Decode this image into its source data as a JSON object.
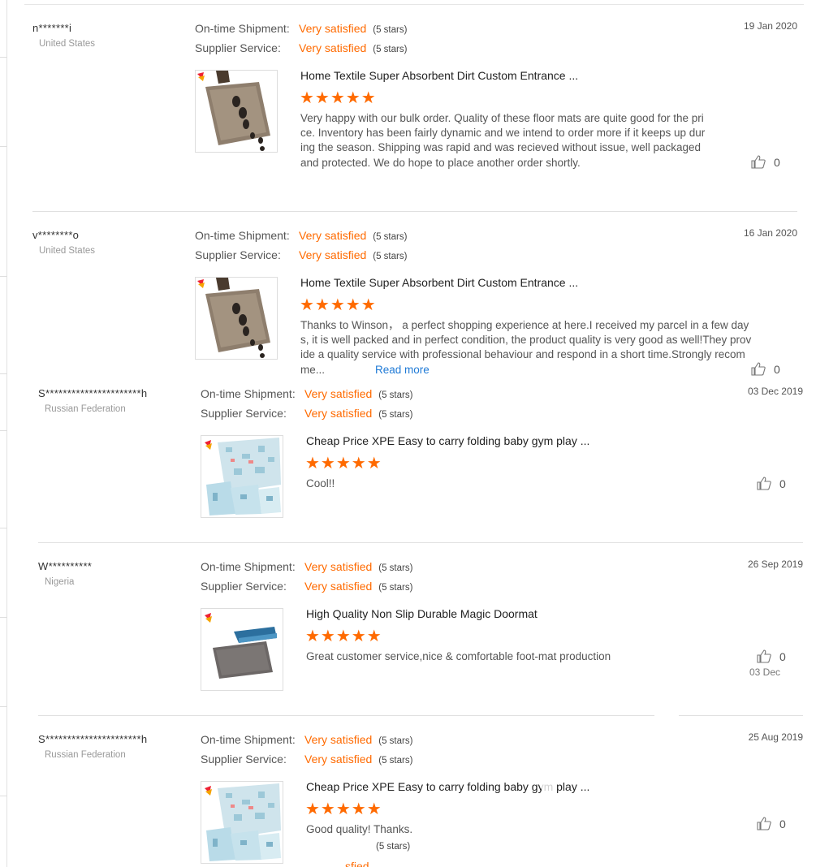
{
  "labels": {
    "shipment": "On-time Shipment:",
    "service": "Supplier Service:"
  },
  "stars_glyph": "★★★★★",
  "icons": {
    "like": "thumbs-up-icon",
    "brand_logo": "supplier-logo-icon"
  },
  "colors": {
    "accent": "#ff6a00",
    "link": "#1f7ad6",
    "muted": "#999999"
  },
  "reviews": [
    {
      "name": "n*******i",
      "country": "United States",
      "shipment_rating": "Very satisfied",
      "shipment_stars": "(5 stars)",
      "service_rating": "Very satisfied",
      "service_stars": "(5 stars)",
      "date": "19 Jan 2020",
      "product_title": "Home Textile Super Absorbent Dirt Custom Entrance ...",
      "product_image": "doormat-footprints",
      "product_stars": 5,
      "text": "Very happy with our bulk order. Quality of these floor mats are quite good for the price. Inventory has been fairly dynamic and we intend to order more if it keeps up during the season. Shipping was rapid and was recieved without issue, well packaged and protected. We do hope to place another order shortly.",
      "likes": "0"
    },
    {
      "name": "v********o",
      "country": "United States",
      "shipment_rating": "Very satisfied",
      "shipment_stars": "(5 stars)",
      "service_rating": "Very satisfied",
      "service_stars": "(5 stars)",
      "date": "16 Jan 2020",
      "product_title": "Home Textile Super Absorbent Dirt Custom Entrance ...",
      "product_image": "doormat-footprints",
      "product_stars": 5,
      "text": "Thanks to Winson， a perfect shopping experience at here.I received my parcel in a few days, it is well packed and in perfect condition, the product quality is very good as well!They provide a quality service with professional behaviour and respond in a short time.Strongly recomme...",
      "read_more": "Read more",
      "likes": "0"
    },
    {
      "name": "S**********************h",
      "country": "Russian Federation",
      "shipment_rating": "Very satisfied",
      "shipment_stars": "(5 stars)",
      "service_rating": "Very satisfied",
      "service_stars": "(5 stars)",
      "date": "03 Dec 2019",
      "product_title": "Cheap Price XPE Easy to carry folding baby gym play ...",
      "product_image": "baby-play-mat",
      "product_stars": 5,
      "text": "Cool!!",
      "likes": "0"
    },
    {
      "name": "W**********",
      "country": "Nigeria",
      "shipment_rating": "Very satisfied",
      "shipment_stars": "(5 stars)",
      "service_rating": "Very satisfied",
      "service_stars": "(5 stars)",
      "date": "26 Sep 2019",
      "product_title": "High Quality Non Slip Durable Magic Doormat",
      "product_image": "grey-doormat",
      "product_stars": 5,
      "text": "Great customer service,nice & comfortable foot-mat production",
      "likes": "0",
      "ghost_date": "03 Dec"
    },
    {
      "name": "S**********************h",
      "country": "Russian Federation",
      "shipment_rating": "Very satisfied",
      "shipment_stars": "(5 stars)",
      "service_rating": "Very satisfied",
      "service_stars": "(5 stars)",
      "date": "25 Aug 2019",
      "product_title": "Cheap Price XPE Easy to carry folding baby gym play ...",
      "product_image": "baby-play-mat",
      "product_stars": 5,
      "text": "Good quality! Thanks.",
      "likes": "0",
      "ghost_stars": "(5 stars)",
      "ghost_rating": "sfied"
    }
  ]
}
